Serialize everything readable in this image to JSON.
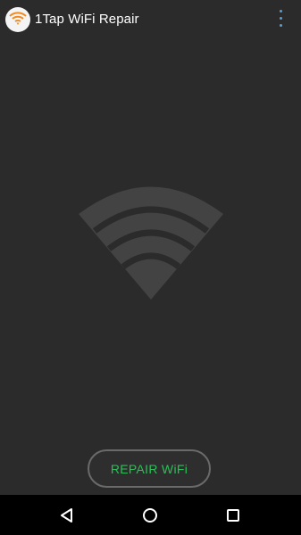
{
  "app": {
    "title": "1Tap WiFi Repair",
    "icon": "wifi-app-icon",
    "menu_icon": "overflow-menu-icon"
  },
  "main": {
    "illustration": "wifi-signal-icon",
    "repair_button_label": "REPAIR WiFi"
  },
  "navigation_bar": {
    "back_icon": "back-triangle-icon",
    "home_icon": "home-circle-icon",
    "recents_icon": "recents-square-icon"
  },
  "colors": {
    "background": "#2b2b2b",
    "accent_green": "#2fbe5a",
    "menu_blue": "#4aa3df",
    "wifi_graphic": "#434343",
    "app_icon_orange": "#f28b1e"
  }
}
